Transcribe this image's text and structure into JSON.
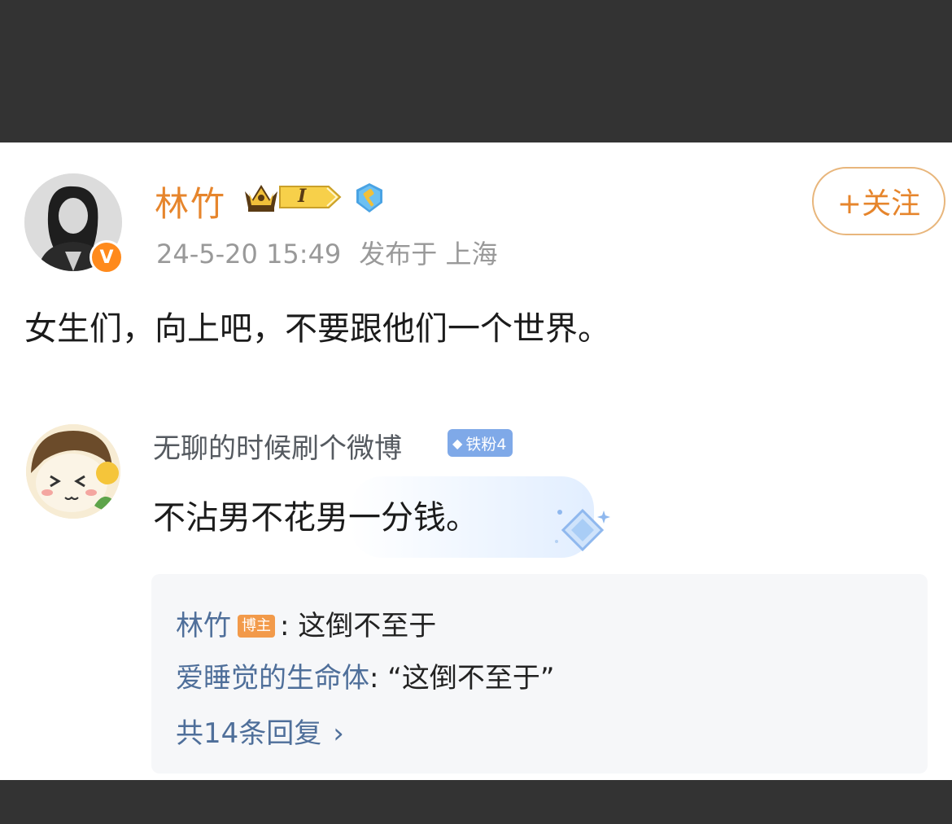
{
  "post": {
    "author": "林竹",
    "level_badge": "I",
    "timestamp": "24-5-20 15:49",
    "published_at": "发布于 上海",
    "follow_label": "+关注",
    "text": "女生们，向上吧，不要跟他们一个世界。"
  },
  "comment": {
    "author": "无聊的时候刷个微博",
    "fan_badge": "铁粉4",
    "text": "不沾男不花男一分钱。"
  },
  "replies": [
    {
      "name": "林竹",
      "badge": "博主",
      "text": ": 这倒不至于"
    },
    {
      "name": "爱睡觉的生命体",
      "badge": "",
      "text": ": “这倒不至于”"
    }
  ],
  "replies_more": "共14条回复",
  "colors": {
    "accent": "#e6852c",
    "reply_name": "#4f6f9a",
    "background": "#333333"
  }
}
